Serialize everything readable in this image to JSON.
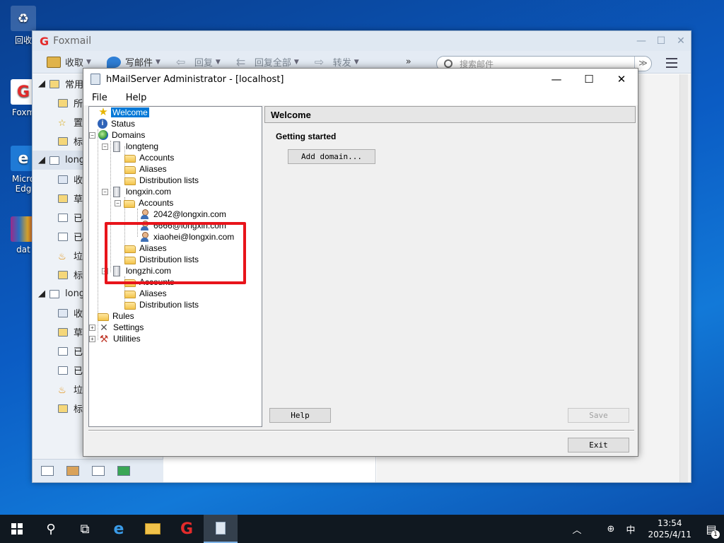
{
  "desktop": {
    "icons": [
      {
        "label": "回收",
        "icon": "recycle-bin-icon"
      },
      {
        "label": "Foxm",
        "icon": "foxmail-icon"
      },
      {
        "label": "Micro Edg",
        "icon": "edge-icon"
      },
      {
        "label": "dat",
        "icon": "winrar-icon"
      }
    ]
  },
  "foxmail": {
    "title": "Foxmail",
    "toolbar": {
      "receive": "收取",
      "compose": "写邮件",
      "reply": "回复",
      "reply_all": "回复全部",
      "forward": "转发",
      "more": "»"
    },
    "search_placeholder": "搜索邮件",
    "left": {
      "common_head": "常用文",
      "common_items": [
        "所",
        "置",
        "标"
      ],
      "account1_head": "longx",
      "account1_items": [
        "收",
        "草",
        "已",
        "已",
        "垃",
        "标"
      ],
      "account2_head": "longx",
      "account2_items": [
        "收",
        "草",
        "已",
        "已",
        "垃",
        "标"
      ]
    }
  },
  "hmail": {
    "title": "hMailServer Administrator - [localhost]",
    "menu": {
      "file": "File",
      "help": "Help"
    },
    "tree": {
      "welcome": "Welcome",
      "status": "Status",
      "domains": "Domains",
      "d1": {
        "name": "longteng",
        "accounts": "Accounts",
        "aliases": "Aliases",
        "dist": "Distribution lists"
      },
      "d2": {
        "name": "longxin.com",
        "accounts": "Accounts",
        "users": [
          "2042@longxin.com",
          "6666@longxin.com",
          "xiaohei@longxin.com"
        ],
        "aliases": "Aliases",
        "dist": "Distribution lists"
      },
      "d3": {
        "name": "longzhi.com",
        "accounts": "Accounts",
        "aliases": "Aliases",
        "dist": "Distribution lists"
      },
      "rules": "Rules",
      "settings": "Settings",
      "utilities": "Utilities"
    },
    "pane": {
      "heading": "Welcome",
      "getting_started": "Getting started",
      "add_domain": "Add domain...",
      "help": "Help",
      "save": "Save",
      "exit": "Exit"
    }
  },
  "taskbar": {
    "ime": "中",
    "time": "13:54",
    "date": "2025/4/11",
    "notifications": "1"
  }
}
